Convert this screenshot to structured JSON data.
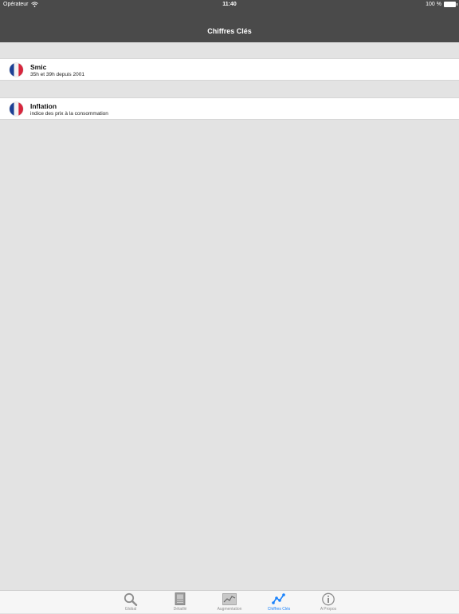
{
  "status_bar": {
    "carrier": "Opérateur",
    "time": "11:40",
    "battery": "100 %"
  },
  "nav": {
    "title": "Chiffres Clés"
  },
  "items": [
    {
      "title": "Smic",
      "subtitle": "35h et 39h depuis 2001",
      "icon": "france-flag-icon"
    },
    {
      "title": "Inflation",
      "subtitle": "indice des prix à la consommation",
      "icon": "france-flag-icon"
    }
  ],
  "tabs": [
    {
      "label": "Global",
      "icon": "magnifier-icon",
      "active": false
    },
    {
      "label": "Détaillé",
      "icon": "document-icon",
      "active": false
    },
    {
      "label": "Augmentation",
      "icon": "chart-icon",
      "active": false
    },
    {
      "label": "Chiffres Clés",
      "icon": "line-graph-icon",
      "active": true
    },
    {
      "label": "A Propos",
      "icon": "info-icon",
      "active": false
    }
  ],
  "colors": {
    "nav_background": "#4a4a4a",
    "page_background": "#e3e3e3",
    "tab_active": "#1a82fb",
    "tab_inactive": "#8e8e8e"
  }
}
